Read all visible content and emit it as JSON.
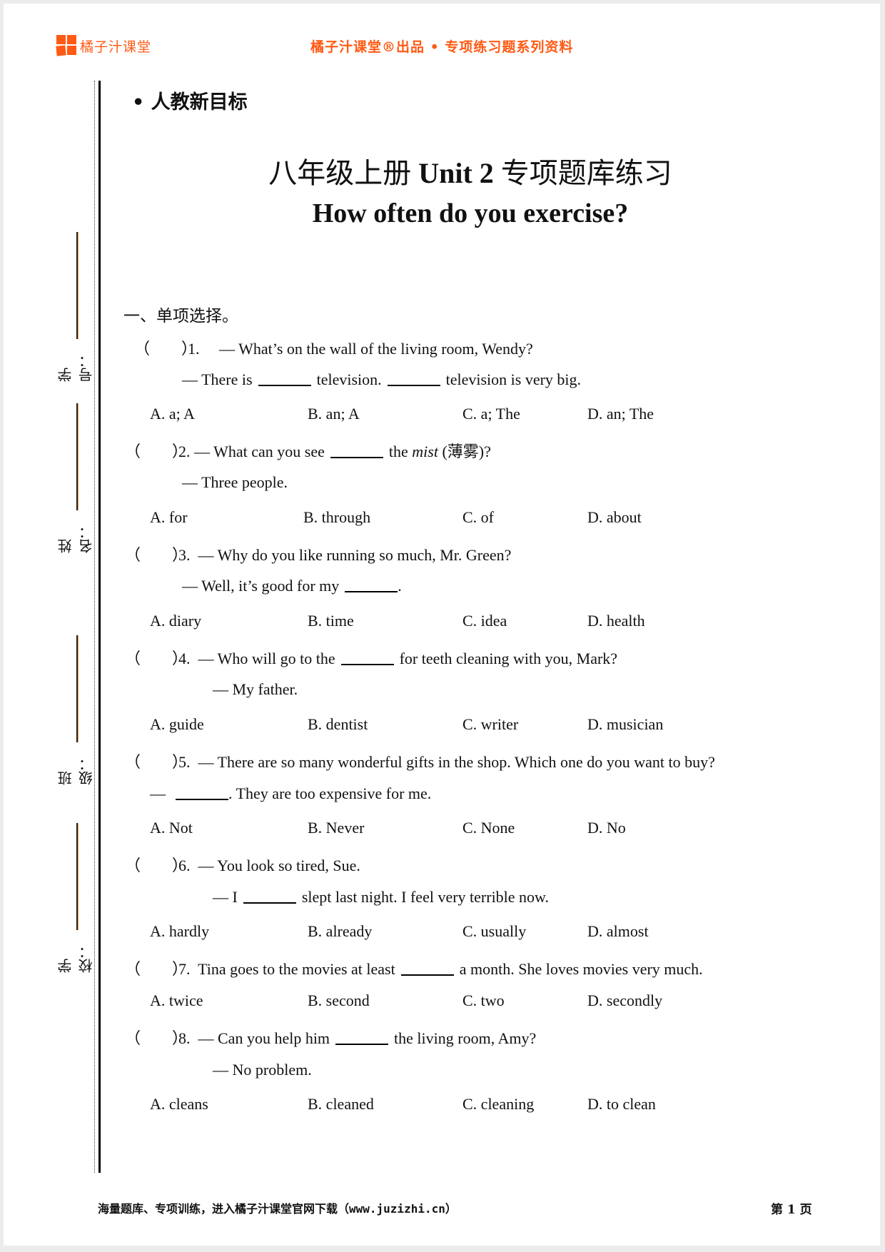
{
  "header": {
    "brand": "橘子汁课堂",
    "center_title": "橘子汁课堂®出品 • 专项练习题系列资料"
  },
  "side_fields": [
    {
      "label": "学号："
    },
    {
      "label": "姓名："
    },
    {
      "label": "班级："
    },
    {
      "label": "学校："
    }
  ],
  "tag": "• 人教新目标",
  "title": {
    "line1_cn_a": "八年级上册 ",
    "line1_en": "Unit 2",
    "line1_cn_b": "  专项题库练习",
    "line2": "How often do you exercise?"
  },
  "section_title": "一、单项选择。",
  "questions": [
    {
      "paren": "（　　）",
      "num": "1.",
      "lines": [
        "— What’s on the wall of the living room, Wendy?",
        "— There is",
        "television.",
        "television is very big."
      ],
      "options": [
        "A. a; A",
        "B. an; A",
        "C. a; The",
        "D. an; The"
      ]
    },
    {
      "paren": "（　　）",
      "num": "2.",
      "lines": [
        "— What can you see",
        "the",
        "mist",
        "(薄雾)?",
        "— Three people."
      ],
      "options": [
        "A. for",
        "B. through",
        "C. of",
        "D. about"
      ]
    },
    {
      "paren": "（　　）",
      "num": "3.",
      "lines": [
        "— Why do you like running so much, Mr. Green?",
        "— Well, it’s good for my",
        "."
      ],
      "options": [
        "A. diary",
        "B. time",
        "C. idea",
        "D. health"
      ]
    },
    {
      "paren": "（　　）",
      "num": "4.",
      "lines": [
        "— Who will go to the",
        "for teeth cleaning with you, Mark?",
        "— My father."
      ],
      "options": [
        "A. guide",
        "B. dentist",
        "C. writer",
        "D. musician"
      ]
    },
    {
      "paren": "（　　）",
      "num": "5.",
      "lines": [
        "— There are so many wonderful gifts in the shop. Which one do you want to buy?",
        "—",
        ". They are too expensive for me."
      ],
      "options": [
        "A. Not",
        "B. Never",
        "C. None",
        "D. No"
      ]
    },
    {
      "paren": "（　　）",
      "num": "6.",
      "lines": [
        "— You look so tired, Sue.",
        "— I",
        "slept last night. I feel very terrible now."
      ],
      "options": [
        "A. hardly",
        "B. already",
        "C. usually",
        "D. almost"
      ]
    },
    {
      "paren": "（　　）",
      "num": "7.",
      "lines": [
        "Tina goes to the movies at least",
        "a month. She loves movies very much."
      ],
      "options": [
        "A. twice",
        "B. second",
        "C. two",
        "D. secondly"
      ]
    },
    {
      "paren": "（　　）",
      "num": "8.",
      "lines": [
        "— Can you help him",
        "the living room, Amy?",
        "— No problem."
      ],
      "options": [
        "A. cleans",
        "B. cleaned",
        "C. cleaning",
        "D. to clean"
      ]
    }
  ],
  "footer": {
    "left": "海量题库、专项训练，进入橘子汁课堂官网下载（www.juzizhi.cn）",
    "page": "第 1 页"
  }
}
